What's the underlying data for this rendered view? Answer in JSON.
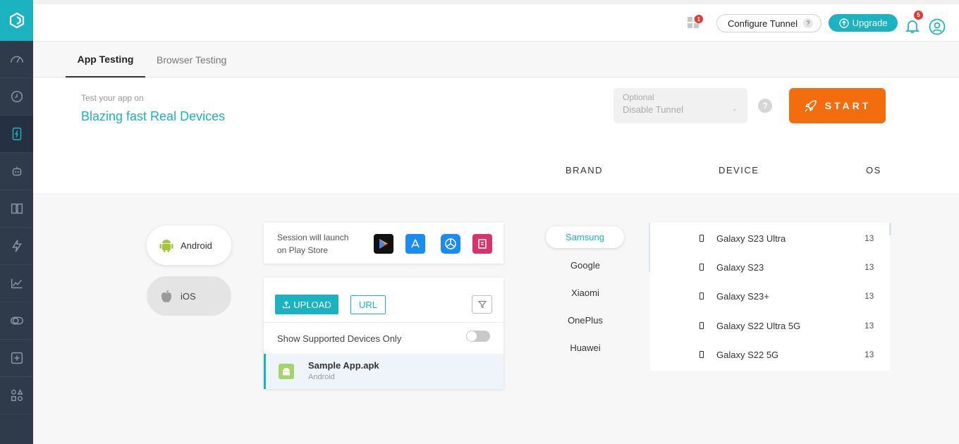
{
  "header": {
    "apps_badge": "1",
    "configure_tunnel": "Configure Tunnel",
    "configure_help": "?",
    "upgrade": "Upgrade",
    "notifications_badge": "5"
  },
  "tabs": [
    {
      "label": "App Testing",
      "active": true
    },
    {
      "label": "Browser Testing",
      "active": false
    }
  ],
  "hero": {
    "subtitle": "Test your app on",
    "title": "Blazing fast Real Devices",
    "tunnel_label": "Optional",
    "tunnel_value": "Disable Tunnel",
    "help": "?",
    "start": "START"
  },
  "columns": {
    "brand": "BRAND",
    "device": "DEVICE",
    "os": "OS"
  },
  "platforms": {
    "android": "Android",
    "ios": "iOS"
  },
  "session": {
    "line1": "Session will launch",
    "line2": "on Play Store"
  },
  "upload": {
    "upload_label": "UPLOAD",
    "url_label": "URL",
    "supported_label": "Show Supported Devices Only",
    "app_name": "Sample App.apk",
    "app_platform": "Android"
  },
  "brands": [
    "Samsung",
    "Google",
    "Xiaomi",
    "OnePlus",
    "Huawei"
  ],
  "devices": [
    {
      "name": "Galaxy S23 Ultra",
      "os": "13"
    },
    {
      "name": "Galaxy S23",
      "os": "13"
    },
    {
      "name": "Galaxy S23+",
      "os": "13"
    },
    {
      "name": "Galaxy S22 Ultra 5G",
      "os": "13"
    },
    {
      "name": "Galaxy S22 5G",
      "os": "13"
    }
  ],
  "colors": {
    "accent": "#1bb3bf",
    "start": "#f36c0e",
    "sidebar": "#2f3a4a"
  }
}
